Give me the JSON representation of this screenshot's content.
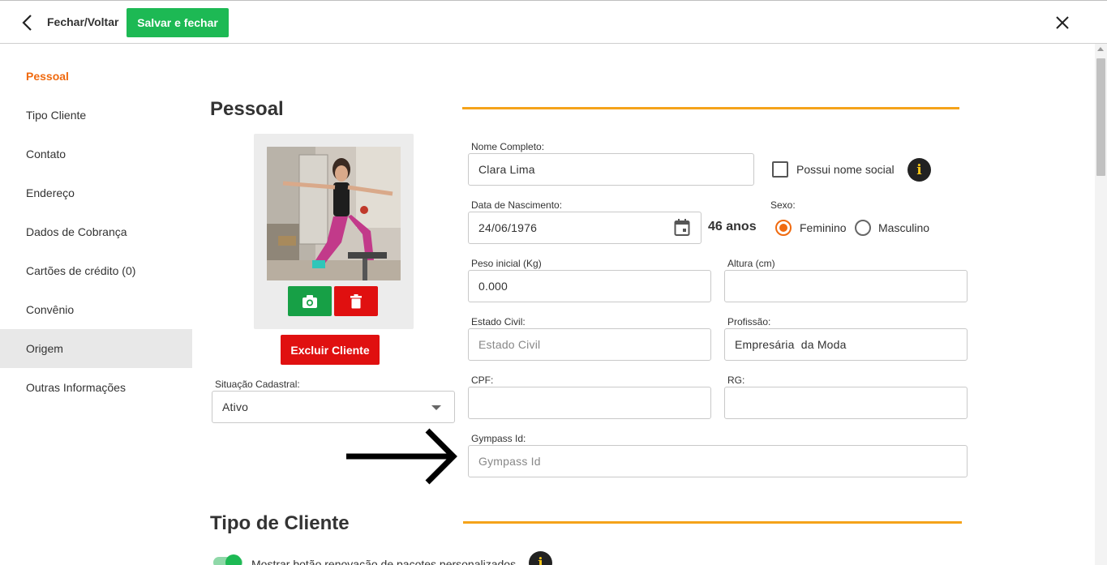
{
  "topbar": {
    "back_label": "Fechar/Voltar",
    "save_label": "Salvar e fechar"
  },
  "sidebar": {
    "items": [
      {
        "label": "Pessoal",
        "state": "active"
      },
      {
        "label": "Tipo Cliente"
      },
      {
        "label": "Contato"
      },
      {
        "label": "Endereço"
      },
      {
        "label": "Dados de Cobrança"
      },
      {
        "label": "Cartões de crédito (0)"
      },
      {
        "label": "Convênio"
      },
      {
        "label": "Origem",
        "state": "selected"
      },
      {
        "label": "Outras Informações"
      }
    ]
  },
  "sections": {
    "pessoal": "Pessoal",
    "tipo_cliente": "Tipo de Cliente"
  },
  "photo": {
    "delete_client_label": "Excluir Cliente"
  },
  "situacao": {
    "label": "Situação Cadastral:",
    "value": "Ativo"
  },
  "form": {
    "nome_label": "Nome Completo:",
    "nome_value": "Clara Lima",
    "nome_social_label": "Possui nome social",
    "nascimento_label": "Data de Nascimento:",
    "nascimento_value": "24/06/1976",
    "idade": "46 anos",
    "sexo_label": "Sexo:",
    "sexo_feminino": "Feminino",
    "sexo_masculino": "Masculino",
    "peso_label": "Peso inicial (Kg)",
    "peso_value": "0.000",
    "altura_label": "Altura (cm)",
    "altura_value": "",
    "estado_civil_label": "Estado Civil:",
    "estado_civil_placeholder": "Estado Civil",
    "profissao_label": "Profissão:",
    "profissao_value": "Empresária  da Moda",
    "cpf_label": "CPF:",
    "cpf_value": "",
    "rg_label": "RG:",
    "rg_value": "",
    "gympass_label": "Gympass Id:",
    "gympass_placeholder": "Gympass Id"
  },
  "tipo_cliente": {
    "toggle_label": "Mostrar botão renovação de pacotes personalizados"
  },
  "colors": {
    "accent": "#f06a0f",
    "save_green": "#1db954",
    "danger_red": "#e01010",
    "section_line": "#f5a31a"
  },
  "icons": {
    "back": "chevron-left-icon",
    "close": "close-icon",
    "camera": "camera-icon",
    "trash": "trash-icon",
    "calendar": "calendar-icon",
    "dropdown": "caret-down-icon",
    "info": "info-icon"
  }
}
